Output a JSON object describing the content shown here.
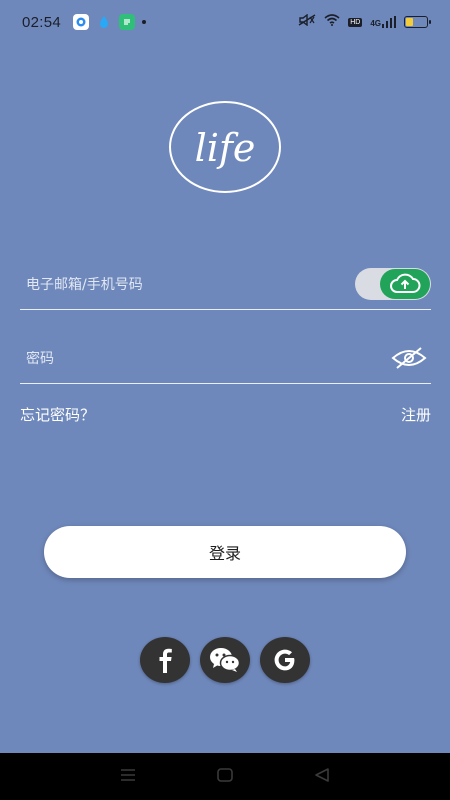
{
  "status_bar": {
    "time": "02:54",
    "network_label": "4G",
    "hd_label": "HD",
    "battery_level": 0.35,
    "icons": [
      "app-icon-blue",
      "droplet-icon",
      "app-icon-green",
      "notification-dot",
      "mute-icon",
      "wifi-icon",
      "hd-icon",
      "signal-icon",
      "battery-icon"
    ]
  },
  "logo": {
    "text": "life"
  },
  "form": {
    "account_placeholder": "电子邮箱/手机号码",
    "account_value": "",
    "password_placeholder": "密码",
    "password_value": "",
    "forgot_label": "忘记密码？",
    "register_label": "注册"
  },
  "login_button_label": "登录",
  "social": [
    "facebook-icon",
    "wechat-icon",
    "google-icon"
  ],
  "colors": {
    "background": "#6f88bb",
    "toggle_on": "#21a45a",
    "social_button": "#333333"
  }
}
